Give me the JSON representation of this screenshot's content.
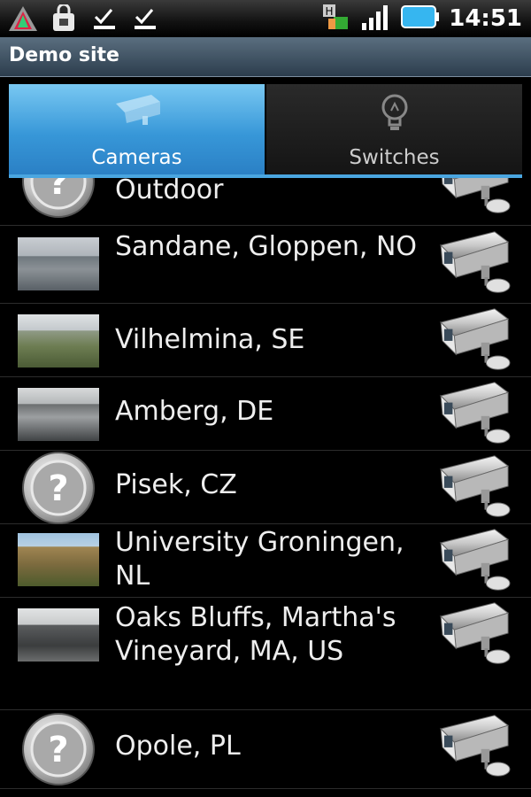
{
  "status": {
    "time": "14:51"
  },
  "app": {
    "title": "Demo site"
  },
  "tabs": [
    {
      "label": "Cameras",
      "icon": "security-camera-icon",
      "active": true
    },
    {
      "label": "Switches",
      "icon": "lightbulb-icon",
      "active": false
    }
  ],
  "cameras": [
    {
      "label": "Outdoor",
      "thumbnail": "unknown"
    },
    {
      "label": "Sandane, Gloppen, NO",
      "thumbnail": "lake-view"
    },
    {
      "label": "Vilhelmina, SE",
      "thumbnail": "town-view"
    },
    {
      "label": "Amberg, DE",
      "thumbnail": "parking-view"
    },
    {
      "label": "Pisek, CZ",
      "thumbnail": "unknown"
    },
    {
      "label": "University Groningen, NL",
      "thumbnail": "building-view"
    },
    {
      "label": "Oaks Bluffs, Martha's Vineyard, MA, US",
      "thumbnail": "harbor-view"
    },
    {
      "label": "Opole, PL",
      "thumbnail": "unknown"
    }
  ]
}
